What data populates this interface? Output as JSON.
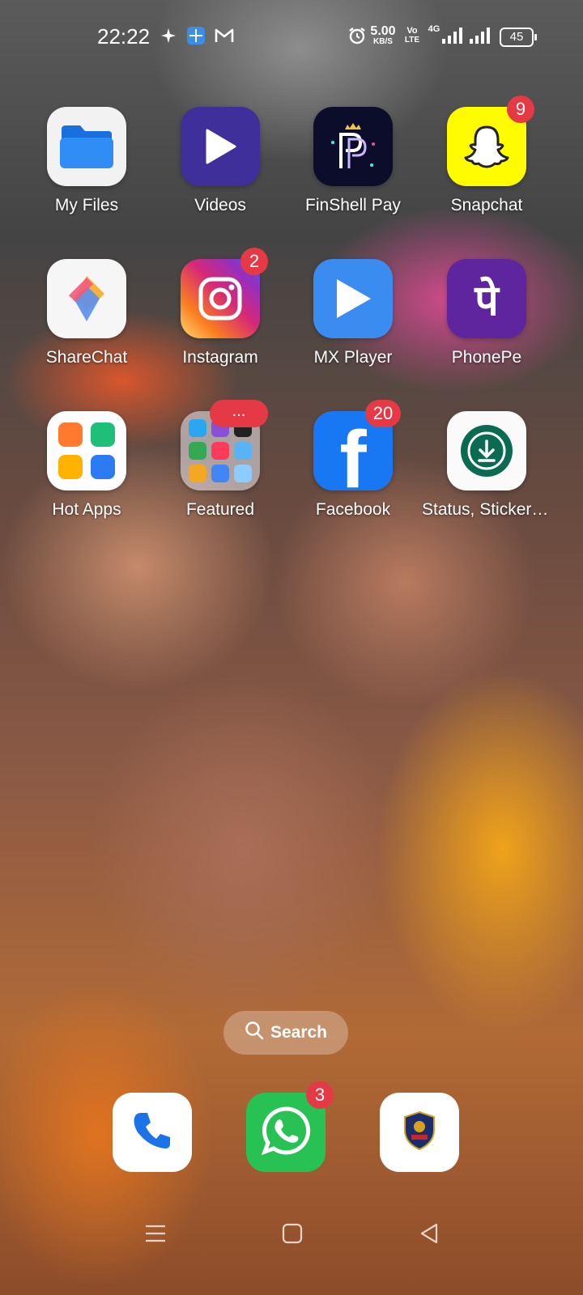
{
  "status_bar": {
    "time": "22:22",
    "speed_value": "5.00",
    "speed_unit": "KB/S",
    "volte_top": "Vo",
    "volte_bottom": "LTE",
    "network": "4G",
    "battery": "45",
    "left_icons": [
      "sparkle-icon",
      "vpn-icon",
      "gmail-icon"
    ],
    "right_icons": [
      "alarm-icon",
      "signal-icon",
      "signal-icon"
    ]
  },
  "apps_row1": [
    {
      "label": "My Files",
      "icon": "folder-icon"
    },
    {
      "label": "Videos",
      "icon": "play-icon"
    },
    {
      "label": "FinShell Pay",
      "icon": "finshell-icon"
    },
    {
      "label": "Snapchat",
      "icon": "ghost-icon",
      "badge": "9"
    }
  ],
  "apps_row2": [
    {
      "label": "ShareChat",
      "icon": "sharechat-icon"
    },
    {
      "label": "Instagram",
      "icon": "camera-icon",
      "badge": "2"
    },
    {
      "label": "MX Player",
      "icon": "play-icon"
    },
    {
      "label": "PhonePe",
      "icon": "phonepe-icon",
      "glyph": "पे"
    }
  ],
  "apps_row3": [
    {
      "label": "Hot Apps",
      "icon": "hot-apps-icon"
    },
    {
      "label": "Featured",
      "icon": "folder-grid-icon",
      "badge": "..."
    },
    {
      "label": "Facebook",
      "icon": "facebook-icon",
      "badge": "20",
      "glyph": "f"
    },
    {
      "label": "Status, Sticker S...",
      "icon": "download-icon"
    }
  ],
  "search": {
    "label": "Search"
  },
  "dock": [
    {
      "name": "phone",
      "icon": "phone-icon"
    },
    {
      "name": "whatsapp",
      "icon": "whatsapp-icon",
      "badge": "3"
    },
    {
      "name": "police",
      "icon": "police-emblem-icon"
    }
  ],
  "colors": {
    "badge": "#e53946",
    "videos": "#3f2f9a",
    "phonepe": "#5f259f",
    "mxplayer": "#3b8cf0",
    "facebook": "#1877f2",
    "whatsapp": "#25d366",
    "snapchat": "#fffc00"
  }
}
